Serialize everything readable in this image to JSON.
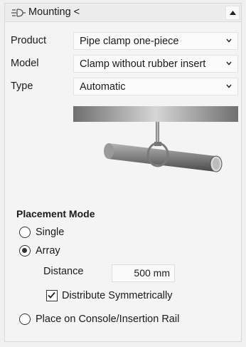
{
  "header": {
    "title": "Mounting <",
    "collapse_icon": "chevron-up-icon",
    "mounting_icon": "pipe-mounting-icon"
  },
  "fields": {
    "product": {
      "label": "Product",
      "value": "Pipe clamp one-piece"
    },
    "model": {
      "label": "Model",
      "value": "Clamp without rubber insert"
    },
    "type": {
      "label": "Type",
      "value": "Automatic"
    }
  },
  "placement": {
    "title": "Placement Mode",
    "options": [
      {
        "label": "Single",
        "selected": false
      },
      {
        "label": "Array",
        "selected": true
      },
      {
        "label": "Place on Console/Insertion Rail",
        "selected": false
      }
    ],
    "distance": {
      "label": "Distance",
      "value": "500 mm"
    },
    "distribute": {
      "label": "Distribute Symmetrically",
      "checked": true
    }
  },
  "colors": {
    "panel_bg": "#f4f4f4",
    "field_bg": "#fbfbfb",
    "pipe_gray": "#8a8a8a"
  }
}
